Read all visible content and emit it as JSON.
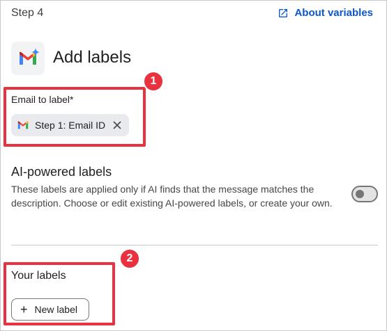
{
  "header": {
    "step_title": "Step 4",
    "about_link": "About variables"
  },
  "main": {
    "app_icon": "gmail-icon",
    "heading": "Add labels",
    "email_field_label": "Email to label*",
    "email_chip_label": "Step 1: Email ID"
  },
  "ai_section": {
    "title": "AI-powered labels",
    "description": "These labels are applied only if AI finds that the message matches the description. Choose or edit existing AI-powered labels, or create your own.",
    "toggle_on": false
  },
  "labels_section": {
    "title": "Your labels",
    "new_label_button": "New label"
  },
  "annotations": {
    "badge_1": "1",
    "badge_2": "2"
  },
  "colors": {
    "accent": "#0b57d0",
    "highlight": "#e8323f"
  }
}
